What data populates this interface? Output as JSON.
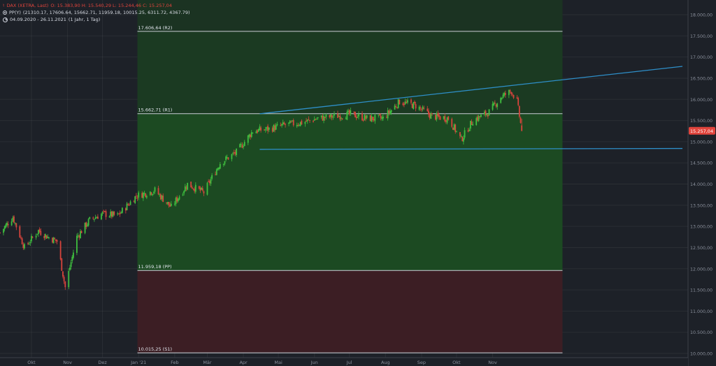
{
  "legend": {
    "symbol_icon": "exchange-symbol-icon",
    "title": "DAX (XETRA, Last)",
    "ohlc": "O: 15.383,90  H: 15.540,29  L: 15.244,46  C: 15.257,04",
    "pp_label": "PP(Y)",
    "pp_values": "(21310.17, 17606.64, 15662.71, 11959.18, 10015.25, 6311.72, 4367.79)",
    "range": "04.09.2020 - 26.11.2021",
    "interval": "(1 Jahr, 1 Tag)"
  },
  "colors": {
    "background": "#1d2128",
    "zone_above_pp": "#1c4a22",
    "zone_r1_r2": "#1b3a22",
    "zone_below_pp": "#3c1e24",
    "up_candle": "#3fbf3f",
    "down_candle": "#d8443c",
    "trendline": "#2e8fc9",
    "pivot_line": "#c9ced6",
    "last_price_badge": "#e0443c"
  },
  "chart_data": {
    "type": "candlestick",
    "title": "DAX (XETRA, Last)",
    "x_tick_labels": [
      "Okt",
      "Nov",
      "Dez",
      "Jan '21",
      "Feb",
      "Mär",
      "Apr",
      "Mai",
      "Jun",
      "Jul",
      "Aug",
      "Sep",
      "Okt",
      "Nov"
    ],
    "y_tick_labels": [
      "10.000,00",
      "10.500,00",
      "11.000,00",
      "11.500,00",
      "12.000,00",
      "12.500,00",
      "13.000,00",
      "13.500,00",
      "14.000,00",
      "14.500,00",
      "15.000,00",
      "15.500,00",
      "16.000,00",
      "16.500,00",
      "17.000,00",
      "17.500,00",
      "18.000,00"
    ],
    "ylim": [
      9950,
      18150
    ],
    "pivot_levels": [
      {
        "label": "17.606,64 (R2)",
        "value": 17606.64,
        "name": "R2"
      },
      {
        "label": "15.662,71 (R1)",
        "value": 15662.71,
        "name": "R1"
      },
      {
        "label": "11.959,18 (PP)",
        "value": 11959.18,
        "name": "PP"
      },
      {
        "label": "10.015,25 (S1)",
        "value": 10015.25,
        "name": "S1"
      }
    ],
    "last_price_label": "15.257,04",
    "last_price": 15257.04,
    "trendlines": [
      {
        "name": "upper-trendline",
        "from": {
          "date": "2021-04-15",
          "value": 15660
        },
        "to": {
          "date": "2022-04-13",
          "value": 16780
        }
      },
      {
        "name": "lower-trendline",
        "from": {
          "date": "2021-04-15",
          "value": 14820
        },
        "to": {
          "date": "2022-04-13",
          "value": 14840
        }
      }
    ],
    "monthly_closes": [
      {
        "date": "2020-09-04",
        "close": 12850
      },
      {
        "date": "2020-09-15",
        "close": 13220
      },
      {
        "date": "2020-09-25",
        "close": 12500
      },
      {
        "date": "2020-10-07",
        "close": 12900
      },
      {
        "date": "2020-10-15",
        "close": 12750
      },
      {
        "date": "2020-10-23",
        "close": 12650
      },
      {
        "date": "2020-10-30",
        "close": 11560
      },
      {
        "date": "2020-11-09",
        "close": 12750
      },
      {
        "date": "2020-11-20",
        "close": 13150
      },
      {
        "date": "2020-12-01",
        "close": 13300
      },
      {
        "date": "2020-12-14",
        "close": 13250
      },
      {
        "date": "2020-12-30",
        "close": 13720
      },
      {
        "date": "2021-01-15",
        "close": 13850
      },
      {
        "date": "2021-01-29",
        "close": 13450
      },
      {
        "date": "2021-02-12",
        "close": 14000
      },
      {
        "date": "2021-02-26",
        "close": 13800
      },
      {
        "date": "2021-03-12",
        "close": 14500
      },
      {
        "date": "2021-03-26",
        "close": 14750
      },
      {
        "date": "2021-04-09",
        "close": 15250
      },
      {
        "date": "2021-04-23",
        "close": 15300
      },
      {
        "date": "2021-05-07",
        "close": 15400
      },
      {
        "date": "2021-05-21",
        "close": 15450
      },
      {
        "date": "2021-06-04",
        "close": 15550
      },
      {
        "date": "2021-06-18",
        "close": 15600
      },
      {
        "date": "2021-07-02",
        "close": 15650
      },
      {
        "date": "2021-07-16",
        "close": 15550
      },
      {
        "date": "2021-07-30",
        "close": 15550
      },
      {
        "date": "2021-08-13",
        "close": 15950
      },
      {
        "date": "2021-08-27",
        "close": 15850
      },
      {
        "date": "2021-09-10",
        "close": 15600
      },
      {
        "date": "2021-09-24",
        "close": 15550
      },
      {
        "date": "2021-10-05",
        "close": 15050
      },
      {
        "date": "2021-10-15",
        "close": 15500
      },
      {
        "date": "2021-10-29",
        "close": 15700
      },
      {
        "date": "2021-11-08",
        "close": 16050
      },
      {
        "date": "2021-11-17",
        "close": 16200
      },
      {
        "date": "2021-11-22",
        "close": 15950
      },
      {
        "date": "2021-11-26",
        "close": 15257.04
      }
    ]
  }
}
